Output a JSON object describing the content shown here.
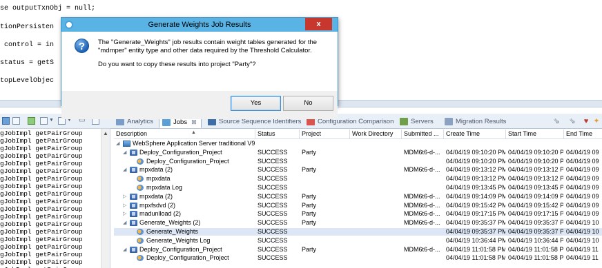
{
  "editor": {
    "lines": [
      "se outputTxnObj = null;",
      "tionPersisten",
      " control = in",
      "status = getS",
      "topLevelObjec"
    ]
  },
  "left_panel": {
    "rows": [
      "gJobImpl getPairGroup",
      "gJobImpl getPairGroup",
      "gJobImpl getPairGroup",
      "gJobImpl getPairGroup",
      "gJobImpl getPairGroup",
      "gJobImpl getPairGroup",
      "gJobImpl getPairGroup",
      "gJobImpl getPairGroup",
      "gJobImpl getPairGroup",
      "gJobImpl getPairGroup",
      "gJobImpl getPairGroup",
      "gJobImpl getPairGroup",
      "gJobImpl getPairGroup",
      "gJobImpl getPairGroup",
      "gJobImpl getPairGroup",
      "gJobImpl getPairGroup",
      "gJobImpl getPairGroup",
      "gJobImpl getPairGroup",
      "gJobImpl getPairGroup"
    ]
  },
  "tabs": [
    {
      "label": "Analytics",
      "icon": "analytics-icon",
      "active": false
    },
    {
      "label": "Jobs",
      "icon": "jobs-icon",
      "active": true,
      "close": "⊠"
    },
    {
      "label": "Source Sequence Identifiers",
      "icon": "sequence-icon",
      "active": false
    },
    {
      "label": "Configuration Comparison",
      "icon": "compare-icon",
      "active": false
    },
    {
      "label": "Servers",
      "icon": "servers-icon",
      "active": false
    },
    {
      "label": "Migration Results",
      "icon": "migration-icon",
      "active": false
    }
  ],
  "table": {
    "columns": [
      "Description",
      "Status",
      "Project",
      "Work Directory",
      "Submitted ...",
      "Create Time",
      "Start Time",
      "End Time"
    ],
    "rows": [
      {
        "level": 0,
        "twisty": "◢",
        "icon": "server",
        "desc": "WebSphere Application Server traditional V9",
        "status": "",
        "project": "",
        "submitted": "",
        "create": "",
        "start": "",
        "end": ""
      },
      {
        "level": 1,
        "twisty": "◢",
        "icon": "job",
        "desc": "Deploy_Configuration_Project",
        "status": "SUCCESS",
        "project": "Party",
        "submitted": "MDM6t6-d-...",
        "create": "04/04/19 09:10:20 PM",
        "start": "04/04/19 09:10:20 PM",
        "end": "04/04/19 09"
      },
      {
        "level": 2,
        "twisty": "",
        "icon": "task",
        "desc": "Deploy_Configuration_Project",
        "status": "SUCCESS",
        "project": "",
        "submitted": "",
        "create": "04/04/19 09:10:20 PM",
        "start": "04/04/19 09:10:20 PM",
        "end": "04/04/19 09"
      },
      {
        "level": 1,
        "twisty": "◢",
        "icon": "job",
        "desc": "mpxdata (2)",
        "status": "SUCCESS",
        "project": "Party",
        "submitted": "MDM6t6-d-...",
        "create": "04/04/19 09:13:12 PM",
        "start": "04/04/19 09:13:12 PM",
        "end": "04/04/19 09"
      },
      {
        "level": 2,
        "twisty": "",
        "icon": "task",
        "desc": "mpxdata",
        "status": "SUCCESS",
        "project": "",
        "submitted": "",
        "create": "04/04/19 09:13:12 PM",
        "start": "04/04/19 09:13:12 PM",
        "end": "04/04/19 09"
      },
      {
        "level": 2,
        "twisty": "",
        "icon": "task",
        "desc": "mpxdata Log",
        "status": "SUCCESS",
        "project": "",
        "submitted": "",
        "create": "04/04/19 09:13:45 PM",
        "start": "04/04/19 09:13:45 PM",
        "end": "04/04/19 09"
      },
      {
        "level": 1,
        "twisty": "▷",
        "icon": "job",
        "desc": "mpxdata (2)",
        "status": "SUCCESS",
        "project": "Party",
        "submitted": "MDM6t6-d-...",
        "create": "04/04/19 09:14:09 PM",
        "start": "04/04/19 09:14:09 PM",
        "end": "04/04/19 09"
      },
      {
        "level": 1,
        "twisty": "▷",
        "icon": "job",
        "desc": "mpxfsdvd (2)",
        "status": "SUCCESS",
        "project": "Party",
        "submitted": "MDM6t6-d-...",
        "create": "04/04/19 09:15:42 PM",
        "start": "04/04/19 09:15:42 PM",
        "end": "04/04/19 09"
      },
      {
        "level": 1,
        "twisty": "▷",
        "icon": "job",
        "desc": "madunlload (2)",
        "status": "SUCCESS",
        "project": "Party",
        "submitted": "MDM6t6-d-...",
        "create": "04/04/19 09:17:15 PM",
        "start": "04/04/19 09:17:15 PM",
        "end": "04/04/19 09"
      },
      {
        "level": 1,
        "twisty": "◢",
        "icon": "job",
        "desc": "Generate_Weights (2)",
        "status": "SUCCESS",
        "project": "Party",
        "submitted": "MDM6t6-d-...",
        "create": "04/04/19 09:35:37 PM",
        "start": "04/04/19 09:35:37 PM",
        "end": "04/04/19 10"
      },
      {
        "level": 2,
        "twisty": "",
        "icon": "task",
        "desc": "Generate_Weights",
        "status": "SUCCESS",
        "project": "",
        "submitted": "",
        "create": "04/04/19 09:35:37 PM",
        "start": "04/04/19 09:35:37 PM",
        "end": "04/04/19 10",
        "selected": true
      },
      {
        "level": 2,
        "twisty": "",
        "icon": "task",
        "desc": "Generate_Weights Log",
        "status": "SUCCESS",
        "project": "",
        "submitted": "",
        "create": "04/04/19 10:36:44 PM",
        "start": "04/04/19 10:36:44 PM",
        "end": "04/04/19 10"
      },
      {
        "level": 1,
        "twisty": "◢",
        "icon": "job",
        "desc": "Deploy_Configuration_Project",
        "status": "SUCCESS",
        "project": "Party",
        "submitted": "MDM6t6-d-...",
        "create": "04/04/19 11:01:58 PM",
        "start": "04/04/19 11:01:58 PM",
        "end": "04/04/19 11"
      },
      {
        "level": 2,
        "twisty": "",
        "icon": "task",
        "desc": "Deploy_Configuration_Project",
        "status": "SUCCESS",
        "project": "",
        "submitted": "",
        "create": "04/04/19 11:01:58 PM",
        "start": "04/04/19 11:01:58 PM",
        "end": "04/04/19 11"
      }
    ]
  },
  "dialog": {
    "title": "Generate Weights Job Results",
    "close_glyph": "x",
    "message": "The \"Generate_Weights\" job results contain weight tables generated for the \"mdmper\" entity type and other data required by the Threshold Calculator.",
    "question": "Do you want to copy these results into project \"Party\"?",
    "yes_label": "Yes",
    "no_label": "No",
    "question_glyph": "?"
  }
}
